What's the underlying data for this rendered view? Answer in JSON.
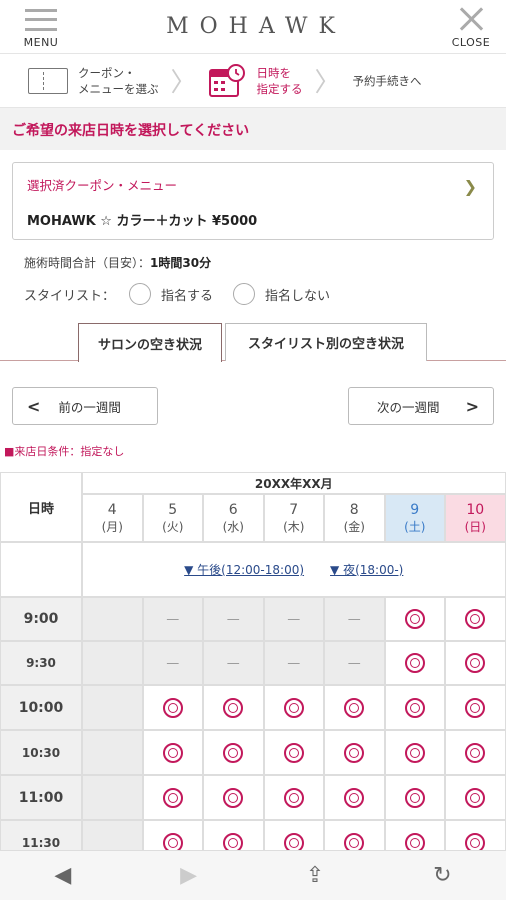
{
  "header": {
    "menu_label": "MENU",
    "logo": "MOHAWK",
    "close_label": "CLOSE"
  },
  "steps": [
    {
      "line1": "クーポン・",
      "line2": "メニューを選ぶ"
    },
    {
      "line1": "日時を",
      "line2": "指定する"
    },
    {
      "line1": "予約手続きへ"
    }
  ],
  "instruction": "ご希望の来店日時を選択してください",
  "selected": {
    "label": "選択済クーポン・メニュー",
    "name": "MOHAWK ☆ カラー＋カット ¥5000"
  },
  "duration": {
    "label": "施術時間合計（目安）：",
    "value": "1時間30分"
  },
  "stylist": {
    "label": "スタイリスト：",
    "opt1": "指名する",
    "opt2": "指名しない"
  },
  "tabs": {
    "salon": "サロンの空き状況",
    "stylist": "スタイリスト別の空き状況"
  },
  "week_nav": {
    "prev": "前の一週間",
    "next": "次の一週間"
  },
  "condition": "■来店日条件：指定なし",
  "calendar": {
    "corner": "日時",
    "month": "20XX年XX月",
    "days": [
      {
        "num": "4",
        "dow": "(月)"
      },
      {
        "num": "5",
        "dow": "(火)"
      },
      {
        "num": "6",
        "dow": "(水)"
      },
      {
        "num": "7",
        "dow": "(木)"
      },
      {
        "num": "8",
        "dow": "(金)"
      },
      {
        "num": "9",
        "dow": "(土)"
      },
      {
        "num": "10",
        "dow": "(日)"
      }
    ],
    "jump_afternoon": "▼ 午後(12:00-18:00)",
    "jump_night": "▼ 夜(18:00-)",
    "times": [
      "9:00",
      "9:30",
      "10:00",
      "10:30",
      "11:00",
      "11:30"
    ],
    "rows": [
      [
        "blank",
        "dash",
        "dash",
        "dash",
        "dash",
        "ok",
        "ok"
      ],
      [
        "blank",
        "dash",
        "dash",
        "dash",
        "dash",
        "ok",
        "ok"
      ],
      [
        "blank",
        "ok",
        "ok",
        "ok",
        "ok",
        "ok",
        "ok"
      ],
      [
        "blank",
        "ok",
        "ok",
        "ok",
        "ok",
        "ok",
        "ok"
      ],
      [
        "blank",
        "ok",
        "ok",
        "ok",
        "ok",
        "ok",
        "ok"
      ],
      [
        "blank",
        "ok",
        "ok",
        "ok",
        "ok",
        "ok",
        "ok"
      ]
    ],
    "dash_symbol": "—"
  },
  "bottom_bar": {
    "back": "◀",
    "forward": "▶",
    "share": "⇪",
    "reload": "↻"
  },
  "colors": {
    "accent": "#c2185b",
    "sat": "#d8e8f5",
    "sun": "#fadbe3",
    "closed": "#ececec"
  }
}
